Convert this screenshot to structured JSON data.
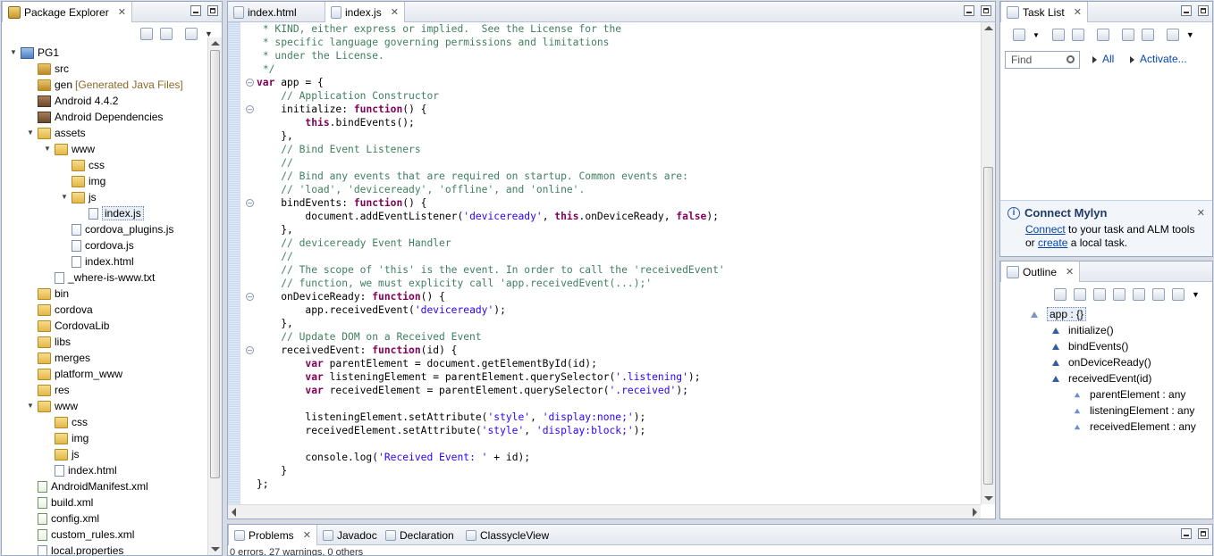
{
  "explorer": {
    "tab_label": "Package Explorer",
    "items": [
      {
        "label": "PG1",
        "depth": 0,
        "icon": "project-icon",
        "expander": "▼"
      },
      {
        "label": "src",
        "depth": 1,
        "icon": "source-folder-icon",
        "expander": ""
      },
      {
        "label": "gen",
        "suffix": "[Generated Java Files]",
        "depth": 1,
        "icon": "source-folder-icon",
        "expander": ""
      },
      {
        "label": "Android 4.4.2",
        "depth": 1,
        "icon": "library-icon",
        "expander": ""
      },
      {
        "label": "Android Dependencies",
        "depth": 1,
        "icon": "library-icon",
        "expander": ""
      },
      {
        "label": "assets",
        "depth": 1,
        "icon": "folder-icon",
        "expander": "▼"
      },
      {
        "label": "www",
        "depth": 2,
        "icon": "folder-icon",
        "expander": "▼"
      },
      {
        "label": "css",
        "depth": 3,
        "icon": "folder-icon",
        "expander": ""
      },
      {
        "label": "img",
        "depth": 3,
        "icon": "folder-icon",
        "expander": ""
      },
      {
        "label": "js",
        "depth": 3,
        "icon": "folder-icon",
        "expander": "▼"
      },
      {
        "label": "index.js",
        "depth": 4,
        "icon": "js-file-icon",
        "expander": "",
        "selected": true
      },
      {
        "label": "cordova_plugins.js",
        "depth": 3,
        "icon": "js-file-icon",
        "expander": ""
      },
      {
        "label": "cordova.js",
        "depth": 3,
        "icon": "js-file-icon",
        "expander": ""
      },
      {
        "label": "index.html",
        "depth": 3,
        "icon": "html-file-icon",
        "expander": ""
      },
      {
        "label": "_where-is-www.txt",
        "depth": 2,
        "icon": "text-file-icon",
        "expander": ""
      },
      {
        "label": "bin",
        "depth": 1,
        "icon": "folder-icon",
        "expander": ""
      },
      {
        "label": "cordova",
        "depth": 1,
        "icon": "folder-icon",
        "expander": ""
      },
      {
        "label": "CordovaLib",
        "depth": 1,
        "icon": "folder-icon",
        "expander": ""
      },
      {
        "label": "libs",
        "depth": 1,
        "icon": "folder-icon",
        "expander": ""
      },
      {
        "label": "merges",
        "depth": 1,
        "icon": "folder-icon",
        "expander": ""
      },
      {
        "label": "platform_www",
        "depth": 1,
        "icon": "folder-icon",
        "expander": ""
      },
      {
        "label": "res",
        "depth": 1,
        "icon": "folder-icon",
        "expander": ""
      },
      {
        "label": "www",
        "depth": 1,
        "icon": "folder-icon",
        "expander": "▼"
      },
      {
        "label": "css",
        "depth": 2,
        "icon": "folder-icon",
        "expander": ""
      },
      {
        "label": "img",
        "depth": 2,
        "icon": "folder-icon",
        "expander": ""
      },
      {
        "label": "js",
        "depth": 2,
        "icon": "folder-icon",
        "expander": ""
      },
      {
        "label": "index.html",
        "depth": 2,
        "icon": "html-file-icon",
        "expander": ""
      },
      {
        "label": "AndroidManifest.xml",
        "depth": 1,
        "icon": "xml-file-icon",
        "expander": ""
      },
      {
        "label": "build.xml",
        "depth": 1,
        "icon": "xml-file-icon",
        "expander": ""
      },
      {
        "label": "config.xml",
        "depth": 1,
        "icon": "xml-file-icon",
        "expander": ""
      },
      {
        "label": "custom_rules.xml",
        "depth": 1,
        "icon": "xml-file-icon",
        "expander": ""
      },
      {
        "label": "local.properties",
        "depth": 1,
        "icon": "text-file-icon",
        "expander": ""
      }
    ]
  },
  "editor": {
    "tabs": [
      {
        "label": "index.html",
        "active": false
      },
      {
        "label": "index.js",
        "active": true
      }
    ],
    "lines": [
      {
        "indent": " ",
        "fold": false,
        "segs": [
          {
            "t": "* KIND, either express or implied.  See the License for the",
            "c": "cm"
          }
        ]
      },
      {
        "indent": " ",
        "fold": false,
        "segs": [
          {
            "t": "* specific language governing permissions and limitations",
            "c": "cm"
          }
        ]
      },
      {
        "indent": " ",
        "fold": false,
        "segs": [
          {
            "t": "* under the License.",
            "c": "cm"
          }
        ]
      },
      {
        "indent": " ",
        "fold": false,
        "segs": [
          {
            "t": "*/",
            "c": "cm"
          }
        ]
      },
      {
        "indent": "",
        "fold": true,
        "segs": [
          {
            "t": "var",
            "c": "kw"
          },
          {
            "t": " app = {",
            "c": ""
          }
        ]
      },
      {
        "indent": "    ",
        "fold": false,
        "segs": [
          {
            "t": "// Application Constructor",
            "c": "cm"
          }
        ]
      },
      {
        "indent": "    ",
        "fold": true,
        "segs": [
          {
            "t": "initialize: ",
            "c": ""
          },
          {
            "t": "function",
            "c": "kw"
          },
          {
            "t": "() {",
            "c": ""
          }
        ]
      },
      {
        "indent": "        ",
        "fold": false,
        "segs": [
          {
            "t": "this",
            "c": "kw"
          },
          {
            "t": ".bindEvents();",
            "c": ""
          }
        ]
      },
      {
        "indent": "    ",
        "fold": false,
        "segs": [
          {
            "t": "},",
            "c": ""
          }
        ]
      },
      {
        "indent": "    ",
        "fold": false,
        "segs": [
          {
            "t": "// Bind Event Listeners",
            "c": "cm"
          }
        ]
      },
      {
        "indent": "    ",
        "fold": false,
        "segs": [
          {
            "t": "//",
            "c": "cm"
          }
        ]
      },
      {
        "indent": "    ",
        "fold": false,
        "segs": [
          {
            "t": "// Bind any events that are required on startup. Common events are:",
            "c": "cm"
          }
        ]
      },
      {
        "indent": "    ",
        "fold": false,
        "segs": [
          {
            "t": "// 'load', 'deviceready', 'offline', and 'online'.",
            "c": "cm"
          }
        ]
      },
      {
        "indent": "    ",
        "fold": true,
        "segs": [
          {
            "t": "bindEvents: ",
            "c": ""
          },
          {
            "t": "function",
            "c": "kw"
          },
          {
            "t": "() {",
            "c": ""
          }
        ]
      },
      {
        "indent": "        ",
        "fold": false,
        "segs": [
          {
            "t": "document.addEventListener(",
            "c": ""
          },
          {
            "t": "'deviceready'",
            "c": "str"
          },
          {
            "t": ", ",
            "c": ""
          },
          {
            "t": "this",
            "c": "kw"
          },
          {
            "t": ".onDeviceReady, ",
            "c": ""
          },
          {
            "t": "false",
            "c": "kw"
          },
          {
            "t": ");",
            "c": ""
          }
        ]
      },
      {
        "indent": "    ",
        "fold": false,
        "segs": [
          {
            "t": "},",
            "c": ""
          }
        ]
      },
      {
        "indent": "    ",
        "fold": false,
        "segs": [
          {
            "t": "// deviceready Event Handler",
            "c": "cm"
          }
        ]
      },
      {
        "indent": "    ",
        "fold": false,
        "segs": [
          {
            "t": "//",
            "c": "cm"
          }
        ]
      },
      {
        "indent": "    ",
        "fold": false,
        "segs": [
          {
            "t": "// The scope of 'this' is the event. In order to call the 'receivedEvent'",
            "c": "cm"
          }
        ]
      },
      {
        "indent": "    ",
        "fold": false,
        "segs": [
          {
            "t": "// function, we must explicity call 'app.receivedEvent(...);'",
            "c": "cm"
          }
        ]
      },
      {
        "indent": "    ",
        "fold": true,
        "segs": [
          {
            "t": "onDeviceReady: ",
            "c": ""
          },
          {
            "t": "function",
            "c": "kw"
          },
          {
            "t": "() {",
            "c": ""
          }
        ]
      },
      {
        "indent": "        ",
        "fold": false,
        "segs": [
          {
            "t": "app.receivedEvent(",
            "c": ""
          },
          {
            "t": "'deviceready'",
            "c": "str"
          },
          {
            "t": ");",
            "c": ""
          }
        ]
      },
      {
        "indent": "    ",
        "fold": false,
        "segs": [
          {
            "t": "},",
            "c": ""
          }
        ]
      },
      {
        "indent": "    ",
        "fold": false,
        "segs": [
          {
            "t": "// Update DOM on a Received Event",
            "c": "cm"
          }
        ]
      },
      {
        "indent": "    ",
        "fold": true,
        "segs": [
          {
            "t": "receivedEvent: ",
            "c": ""
          },
          {
            "t": "function",
            "c": "kw"
          },
          {
            "t": "(id) {",
            "c": ""
          }
        ]
      },
      {
        "indent": "        ",
        "fold": false,
        "segs": [
          {
            "t": "var",
            "c": "kw"
          },
          {
            "t": " parentElement = document.getElementById(id);",
            "c": ""
          }
        ]
      },
      {
        "indent": "        ",
        "fold": false,
        "segs": [
          {
            "t": "var",
            "c": "kw"
          },
          {
            "t": " listeningElement = parentElement.querySelector(",
            "c": ""
          },
          {
            "t": "'.listening'",
            "c": "str"
          },
          {
            "t": ");",
            "c": ""
          }
        ]
      },
      {
        "indent": "        ",
        "fold": false,
        "segs": [
          {
            "t": "var",
            "c": "kw"
          },
          {
            "t": " receivedElement = parentElement.querySelector(",
            "c": ""
          },
          {
            "t": "'.received'",
            "c": "str"
          },
          {
            "t": ");",
            "c": ""
          }
        ]
      },
      {
        "indent": "",
        "fold": false,
        "segs": []
      },
      {
        "indent": "        ",
        "fold": false,
        "segs": [
          {
            "t": "listeningElement.setAttribute(",
            "c": ""
          },
          {
            "t": "'style'",
            "c": "str"
          },
          {
            "t": ", ",
            "c": ""
          },
          {
            "t": "'display:none;'",
            "c": "str"
          },
          {
            "t": ");",
            "c": ""
          }
        ]
      },
      {
        "indent": "        ",
        "fold": false,
        "segs": [
          {
            "t": "receivedElement.setAttribute(",
            "c": ""
          },
          {
            "t": "'style'",
            "c": "str"
          },
          {
            "t": ", ",
            "c": ""
          },
          {
            "t": "'display:block;'",
            "c": "str"
          },
          {
            "t": ");",
            "c": ""
          }
        ]
      },
      {
        "indent": "",
        "fold": false,
        "segs": []
      },
      {
        "indent": "        ",
        "fold": false,
        "segs": [
          {
            "t": "console.log(",
            "c": ""
          },
          {
            "t": "'Received Event: '",
            "c": "str"
          },
          {
            "t": " + id);",
            "c": ""
          }
        ]
      },
      {
        "indent": "    ",
        "fold": false,
        "segs": [
          {
            "t": "}",
            "c": ""
          }
        ]
      },
      {
        "indent": "",
        "fold": false,
        "segs": [
          {
            "t": "};",
            "c": ""
          }
        ]
      }
    ]
  },
  "tasklist": {
    "tab_label": "Task List",
    "find_placeholder": "Find",
    "all_label": "All",
    "activate_label": "Activate...",
    "mylyn_title": "Connect Mylyn",
    "mylyn_link_connect": "Connect",
    "mylyn_text_1": " to your task and ALM tools",
    "mylyn_text_or": "or ",
    "mylyn_link_create": "create",
    "mylyn_text_2": " a local task."
  },
  "outline": {
    "tab_label": "Outline",
    "items": [
      {
        "label": "app : {}",
        "depth": 0,
        "kind": "root"
      },
      {
        "label": "initialize()",
        "depth": 1,
        "kind": "method"
      },
      {
        "label": "bindEvents()",
        "depth": 1,
        "kind": "method"
      },
      {
        "label": "onDeviceReady()",
        "depth": 1,
        "kind": "method"
      },
      {
        "label": "receivedEvent(id)",
        "depth": 1,
        "kind": "method"
      },
      {
        "label": "parentElement : any",
        "depth": 2,
        "kind": "var"
      },
      {
        "label": "listeningElement : any",
        "depth": 2,
        "kind": "var"
      },
      {
        "label": "receivedElement : any",
        "depth": 2,
        "kind": "var"
      }
    ]
  },
  "bottom": {
    "tabs": [
      {
        "label": "Problems",
        "icon": "problems-icon",
        "active": true
      },
      {
        "label": "Javadoc",
        "icon": "javadoc-icon",
        "active": false
      },
      {
        "label": "Declaration",
        "icon": "declaration-icon",
        "active": false
      },
      {
        "label": "ClassycleView",
        "icon": "classycle-icon",
        "active": false
      }
    ],
    "status": "0 errors, 27 warnings, 0 others"
  },
  "colors": {
    "keyword": "#7f0055",
    "comment": "#3f7f5f",
    "string": "#2a00ff",
    "link": "#0645ad"
  }
}
